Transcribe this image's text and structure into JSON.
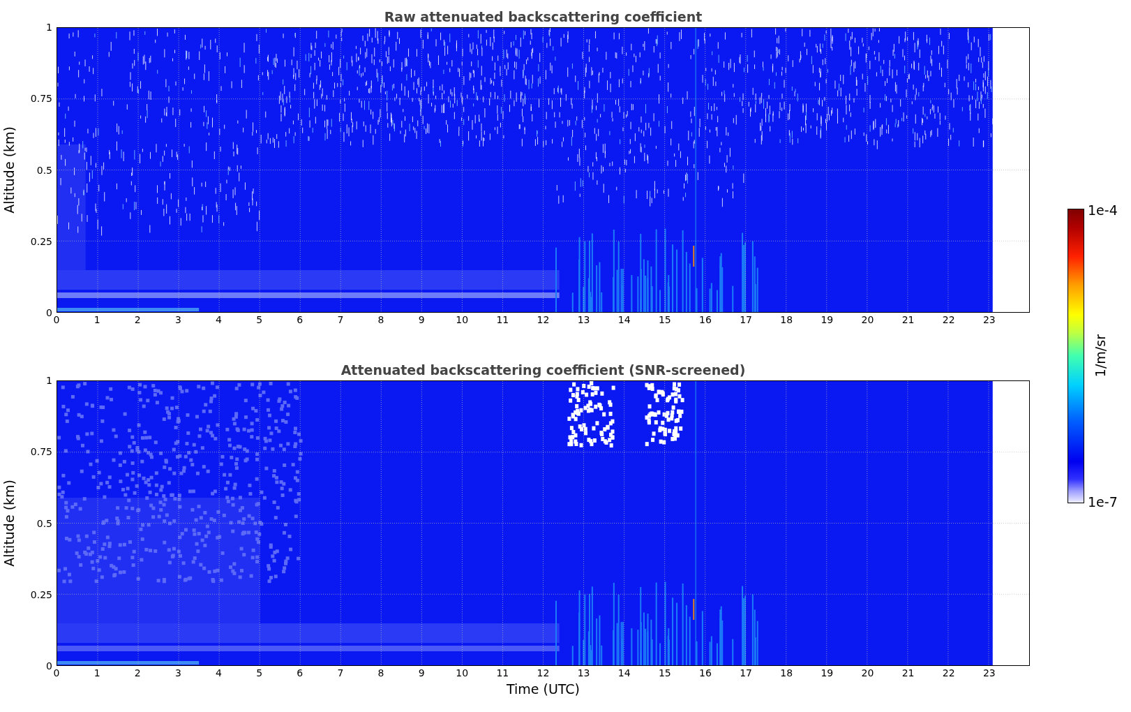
{
  "panels": [
    {
      "kind": "raw",
      "title": "Raw attenuated backscattering coefficient",
      "ylabel": "Altitude (km)",
      "yticks": [
        "1",
        "0.75",
        "0.5",
        "0.25",
        "0"
      ],
      "xticks": [
        "0",
        "1",
        "2",
        "3",
        "4",
        "5",
        "6",
        "7",
        "8",
        "9",
        "10",
        "11",
        "12",
        "13",
        "14",
        "15",
        "16",
        "17",
        "18",
        "19",
        "20",
        "21",
        "22",
        "23"
      ]
    },
    {
      "kind": "screened",
      "title": "Attenuated backscattering coefficient (SNR-screened)",
      "ylabel": "Altitude (km)",
      "yticks": [
        "1",
        "0.75",
        "0.5",
        "0.25",
        "0"
      ],
      "xticks": [
        "0",
        "1",
        "2",
        "3",
        "4",
        "5",
        "6",
        "7",
        "8",
        "9",
        "10",
        "11",
        "12",
        "13",
        "14",
        "15",
        "16",
        "17",
        "18",
        "19",
        "20",
        "21",
        "22",
        "23"
      ]
    }
  ],
  "xlabel": "Time (UTC)",
  "colorbar": {
    "max_label": "1e-4",
    "min_label": "1e-7",
    "label": "1/m/sr"
  }
}
